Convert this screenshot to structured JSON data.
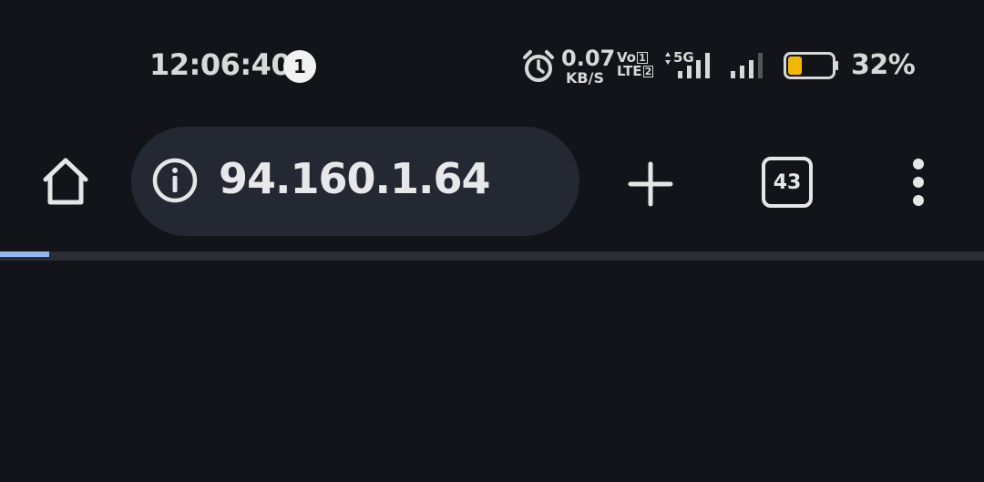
{
  "status_bar": {
    "time": "12:06:40",
    "notification_count": "1",
    "net_speed_value": "0.07",
    "net_speed_unit": "KB/S",
    "volte_top": "Vo",
    "volte_bottom": "LTE",
    "sim1": "1",
    "sim2": "2",
    "network_type": "5G",
    "battery_percent": "32%",
    "battery_level": 0.32,
    "battery_color": "#f5b800",
    "icons": [
      "alarm-icon",
      "signal-icon",
      "battery-icon"
    ]
  },
  "toolbar": {
    "url": "94.160.1.64",
    "tab_count": "43",
    "icons": [
      "home-icon",
      "info-icon",
      "plus-icon",
      "more-vert-icon"
    ]
  },
  "progress": {
    "fraction": 0.05,
    "color": "#8fb7ee"
  },
  "colors": {
    "background": "#131419",
    "url_bar": "#232833",
    "foreground": "#e6e6e6"
  }
}
